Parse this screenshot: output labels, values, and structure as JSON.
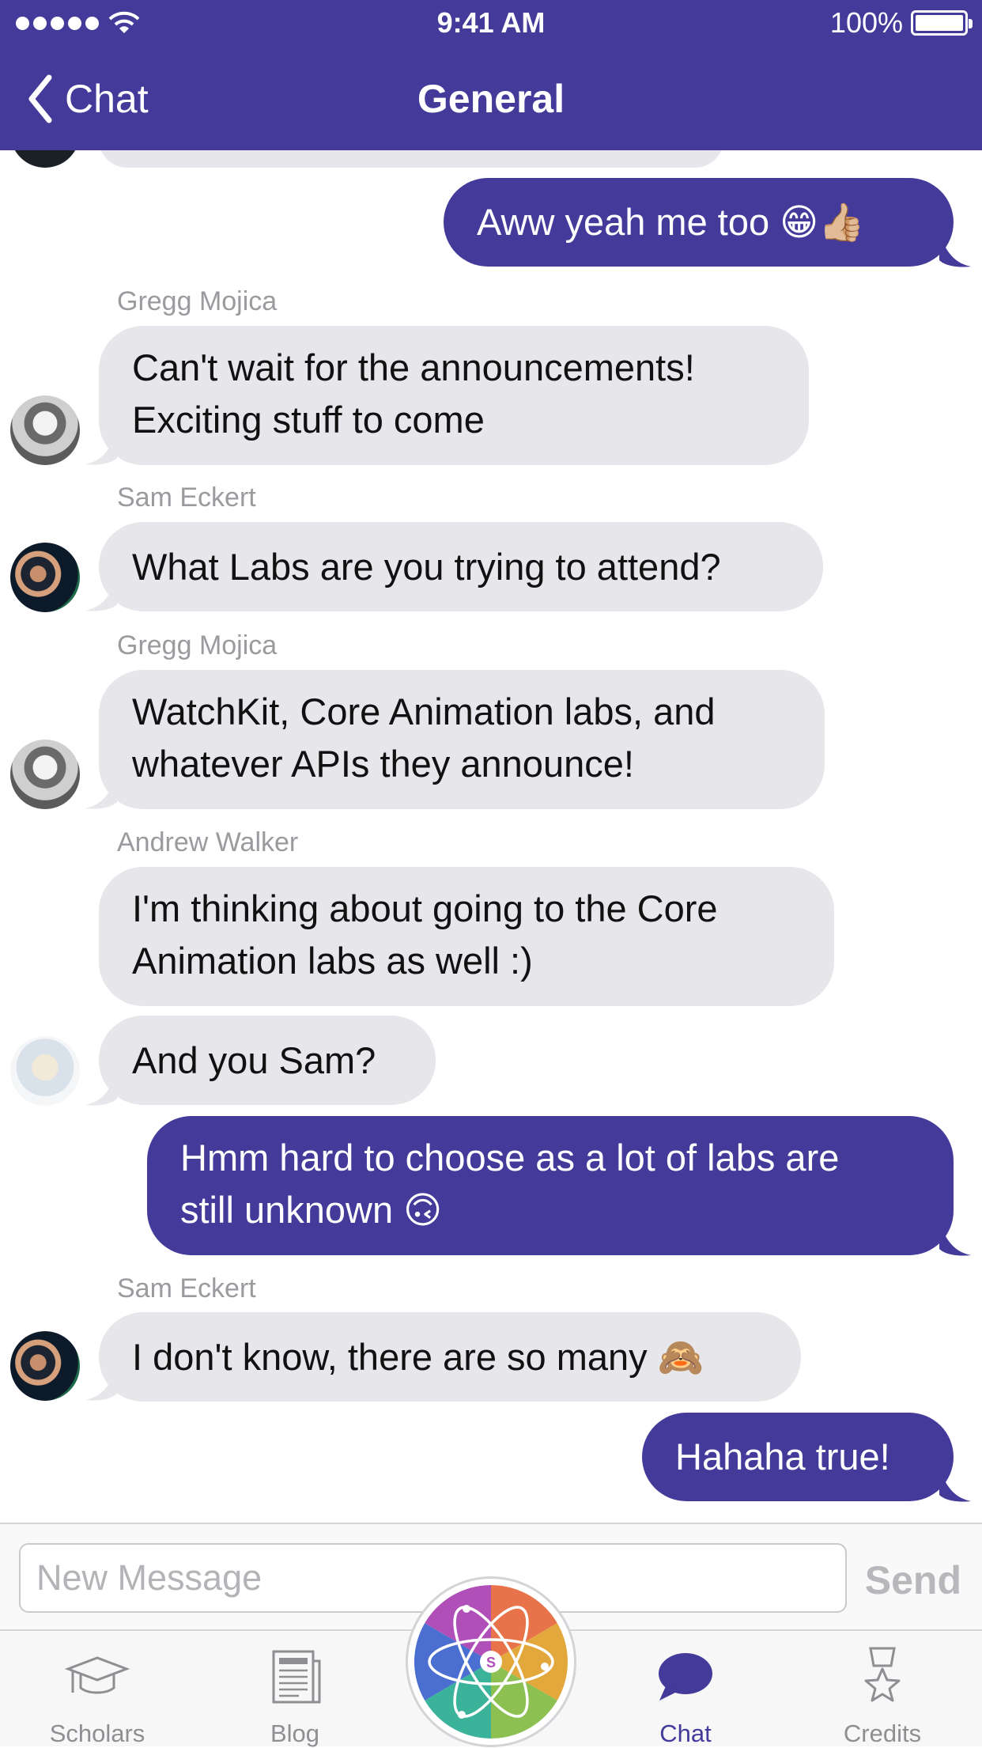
{
  "status_bar": {
    "time": "9:41 AM",
    "battery": "100%"
  },
  "nav": {
    "back_label": "Chat",
    "title": "General"
  },
  "messages": [
    {
      "type": "outgoing",
      "text": "Aww yeah me too 😁👍🏼"
    },
    {
      "type": "incoming",
      "sender": "Gregg Mojica",
      "line1": "Can't wait for the announcements!",
      "line2": "Exciting stuff to come"
    },
    {
      "type": "incoming",
      "sender": "Sam Eckert",
      "text": "What Labs are you trying to attend?"
    },
    {
      "type": "incoming",
      "sender": "Gregg Mojica",
      "line1": "WatchKit, Core Animation labs, and",
      "line2": "whatever APIs they announce!"
    },
    {
      "type": "incoming",
      "sender": "Andrew Walker",
      "line1": "I'm thinking about going to the Core",
      "line2": "Animation labs as well :)"
    },
    {
      "type": "incoming",
      "text": "And you Sam?"
    },
    {
      "type": "outgoing",
      "line1": "Hmm hard to choose as a lot of labs are",
      "line2": "still unknown 🙃"
    },
    {
      "type": "incoming",
      "sender": "Sam Eckert",
      "text": "I don't know, there are so many 🙈"
    },
    {
      "type": "outgoing",
      "text": "Hahaha true!"
    }
  ],
  "composer": {
    "placeholder": "New Message",
    "send_label": "Send"
  },
  "tabs": [
    {
      "label": "Scholars",
      "icon": "graduation-cap-icon"
    },
    {
      "label": "Blog",
      "icon": "newspaper-icon"
    },
    {
      "label": "Chat",
      "icon": "chat-bubble-icon",
      "active": true
    },
    {
      "label": "Credits",
      "icon": "medal-star-icon"
    }
  ],
  "center_logo": {
    "letter": "S"
  },
  "colors": {
    "accent": "#433a9a",
    "incoming_bubble": "#e6e6eb",
    "muted": "#8e8e93"
  }
}
